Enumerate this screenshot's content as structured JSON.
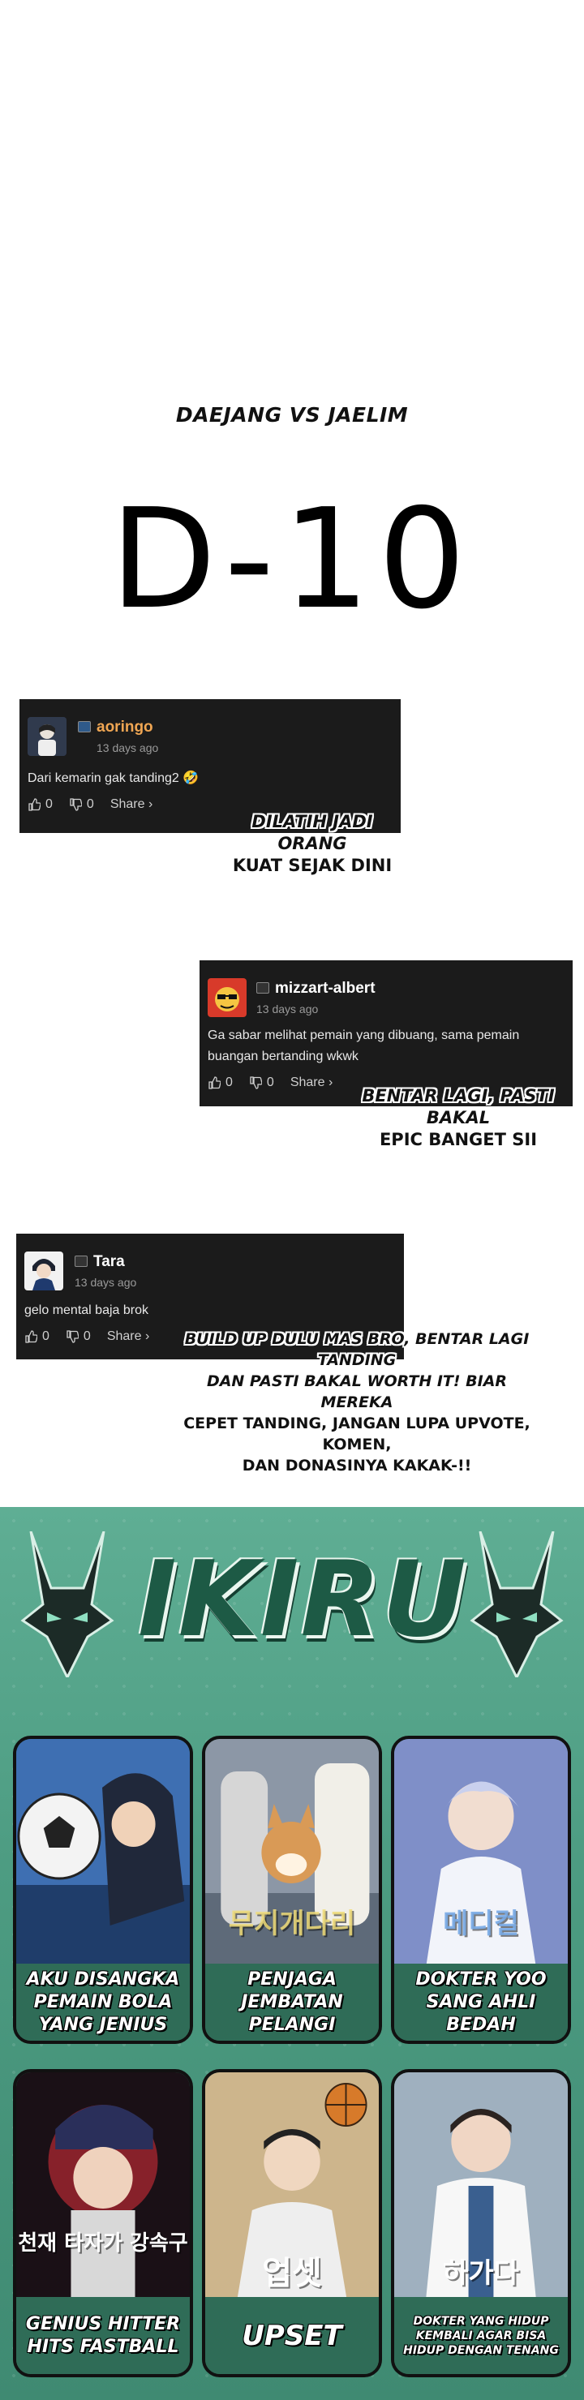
{
  "header": {
    "subtitle": "DAEJANG VS JAELIM",
    "countdown": "D-10"
  },
  "comments": [
    {
      "username": "aoringo",
      "date": "13 days ago",
      "text": "Dari kemarin gak tanding2 🤣",
      "likes": "0",
      "dislikes": "0",
      "share": "Share ›",
      "caption": [
        "DILATIH JADI ORANG",
        "KUAT SEJAK DINI"
      ]
    },
    {
      "username": "mizzart-albert",
      "date": "13 days ago",
      "text": "Ga sabar melihat pemain yang dibuang, sama pemain buangan bertanding wkwk",
      "likes": "0",
      "dislikes": "0",
      "share": "Share ›",
      "caption": [
        "BENTAR LAGI, PASTI BAKAL",
        "EPIC BANGET SII"
      ]
    },
    {
      "username": "Tara",
      "date": "13 days ago",
      "text": "gelo mental baja brok",
      "likes": "0",
      "dislikes": "0",
      "share": "Share ›",
      "caption": [
        "BUILD UP DULU MAS BRO, BENTAR LAGI TANDING",
        "DAN PASTI BAKAL WORTH IT! BIAR MEREKA",
        "CEPET TANDING, JANGAN LUPA UPVOTE, KOMEN,",
        "DAN DONASINYA KAKAK-!!"
      ]
    }
  ],
  "promo": {
    "title": "IKIRU",
    "colors": {
      "background": "#4d9c82",
      "title": "#1d5a45",
      "tile_border": "#111111"
    },
    "tiles": [
      {
        "label": "AKU DISANGKA PEMAIN BOLA YANG JENIUS",
        "art_text": "",
        "icon": "soccer-ball-icon",
        "color": "#3e6fb2"
      },
      {
        "label": "PENJAGA JEMBATAN PELANGI",
        "art_text": "무지개다리",
        "icon": "dog-icon",
        "color": "#8c97a6"
      },
      {
        "label": "DOKTER YOO SANG AHLI BEDAH",
        "art_text": "메디컬",
        "icon": "doctor-icon",
        "color": "#7f8fc8"
      },
      {
        "label": "GENIUS HITTER HITS FASTBALL",
        "art_text": "천재 타자가 강속구",
        "icon": "baseball-icon",
        "color": "#a3252f"
      },
      {
        "label": "UPSET",
        "art_text": "업셋",
        "icon": "basketball-icon",
        "color": "#cdb58c"
      },
      {
        "label": "DOKTER YANG HIDUP KEMBALI AGAR BISA HIDUP DENGAN TENANG",
        "art_text": "하가다",
        "icon": "stethoscope-icon",
        "color": "#9fb0bf"
      }
    ]
  }
}
